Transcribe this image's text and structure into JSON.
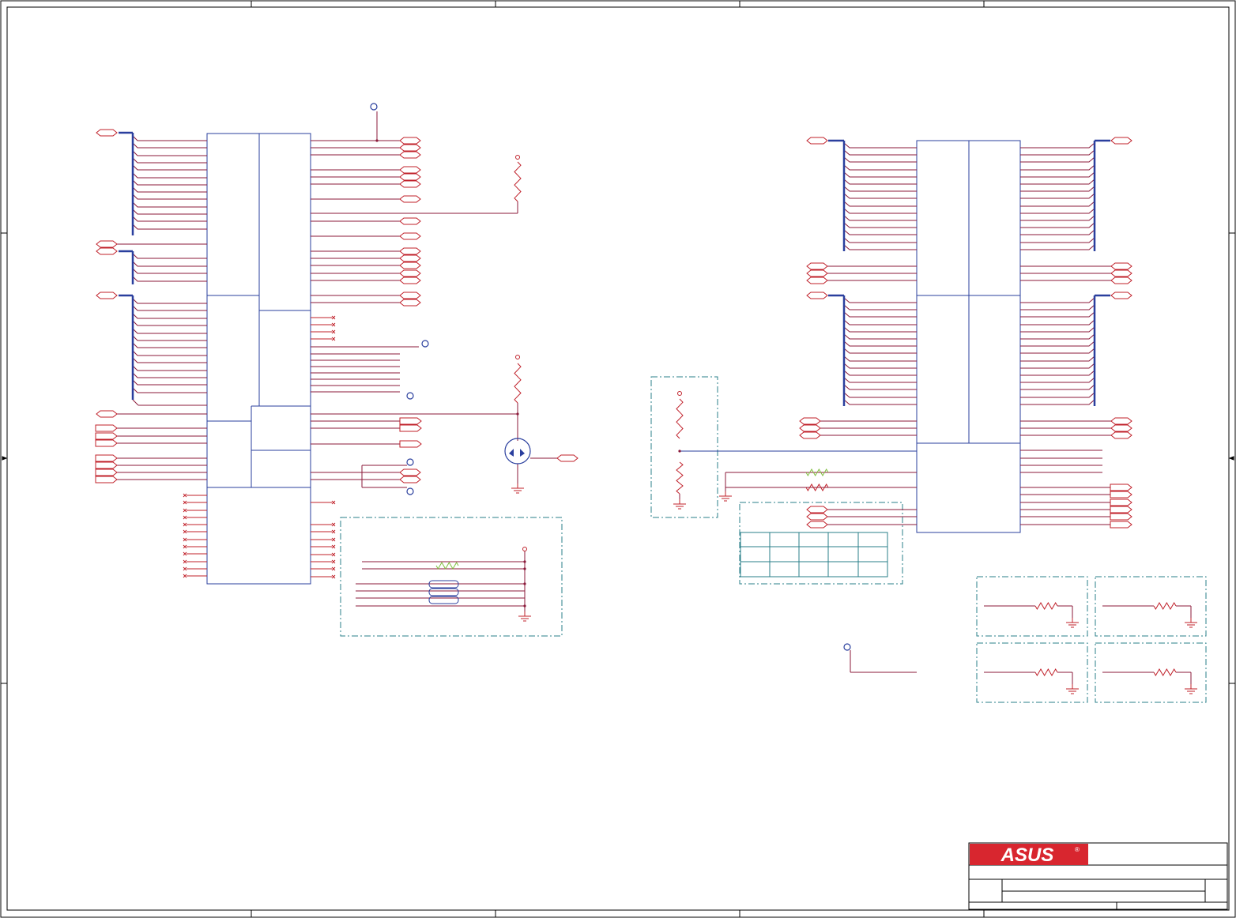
{
  "title_block": {
    "logo_text": "ASUS",
    "logo_mark": "®"
  },
  "colors": {
    "wire": "#c0202a",
    "wire_dark": "#8b1a3a",
    "bus": "#2a3f9e",
    "box": "#2a3f9e",
    "dash_box": "#2a7f8a",
    "ground": "#c0202a",
    "resistor_green": "#7fbf3f",
    "logo_bg": "#d8262f",
    "frame": "#000000"
  },
  "icons": {
    "ground": "ground-symbol-icon",
    "resistor": "resistor-icon",
    "mosfet": "mosfet-icon",
    "power_port": "power-port-icon",
    "test_point": "test-point-icon",
    "no_connect": "no-connect-x-icon",
    "off_page_connector": "off-page-connector-icon"
  }
}
